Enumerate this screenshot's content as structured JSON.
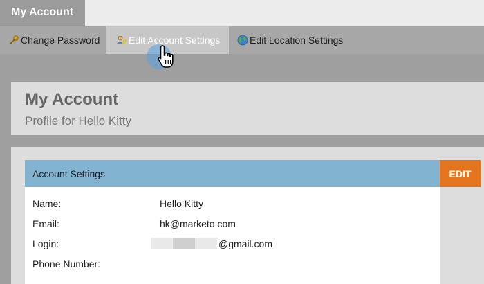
{
  "top_tab": {
    "label": "My Account"
  },
  "subnav": {
    "items": [
      {
        "label": "Change Password",
        "icon": "key-icon"
      },
      {
        "label": "Edit Account Settings",
        "icon": "user-edit-icon"
      },
      {
        "label": "Edit Location Settings",
        "icon": "globe-icon"
      }
    ]
  },
  "page": {
    "title": "My Account",
    "subtitle": "Profile for Hello Kitty"
  },
  "account_settings": {
    "header": "Account Settings",
    "edit_label": "EDIT",
    "fields": {
      "name": {
        "label": "Name:",
        "value": "Hello Kitty"
      },
      "email": {
        "label": "Email:",
        "value": "hk@marketo.com"
      },
      "login": {
        "label": "Login:",
        "value_suffix": "@gmail.com"
      },
      "phone": {
        "label": "Phone Number:",
        "value": ""
      }
    }
  },
  "colors": {
    "header_bar": "#82b4d2",
    "edit_button": "#e4751e",
    "cursor_highlight": "#56a0e2"
  }
}
